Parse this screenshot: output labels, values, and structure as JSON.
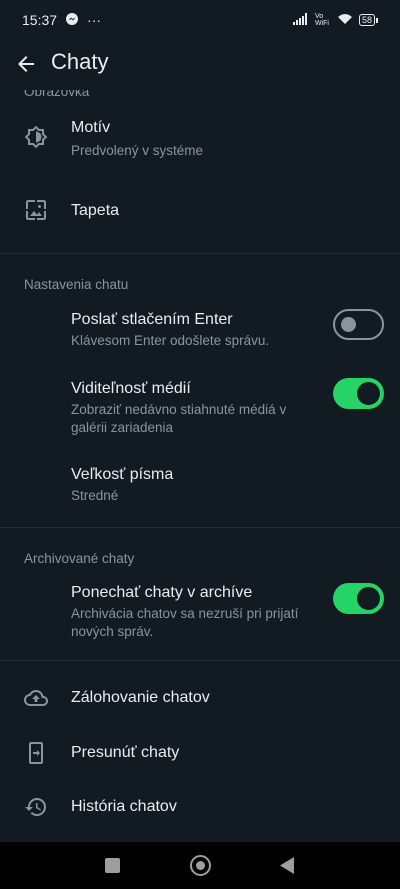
{
  "status": {
    "time": "15:37",
    "dots": "···",
    "network": "Vo WiFi",
    "battery": "58"
  },
  "header": {
    "title": "Chaty"
  },
  "sections": {
    "display": "Obrazovka",
    "chat_settings": "Nastavenia chatu",
    "archived": "Archivované chaty"
  },
  "theme": {
    "title": "Motív",
    "subtitle": "Predvolený v systéme"
  },
  "wallpaper": {
    "title": "Tapeta"
  },
  "enter_send": {
    "title": "Poslať stlačením Enter",
    "subtitle": "Klávesom Enter odošlete správu.",
    "enabled": false
  },
  "media_visibility": {
    "title": "Viditeľnosť médií",
    "subtitle": "Zobraziť nedávno stiahnuté médiá v galérii zariadenia",
    "enabled": true
  },
  "font_size": {
    "title": "Veľkosť písma",
    "subtitle": "Stredné"
  },
  "keep_archived": {
    "title": "Ponechať chaty v archíve",
    "subtitle": "Archivácia chatov sa nezruší pri prijatí nových správ.",
    "enabled": true
  },
  "backup": {
    "title": "Zálohovanie chatov"
  },
  "transfer": {
    "title": "Presunúť chaty"
  },
  "history": {
    "title": "História chatov"
  },
  "colors": {
    "background": "#121b22",
    "accent": "#25d366",
    "secondary_text": "#8696a0"
  }
}
